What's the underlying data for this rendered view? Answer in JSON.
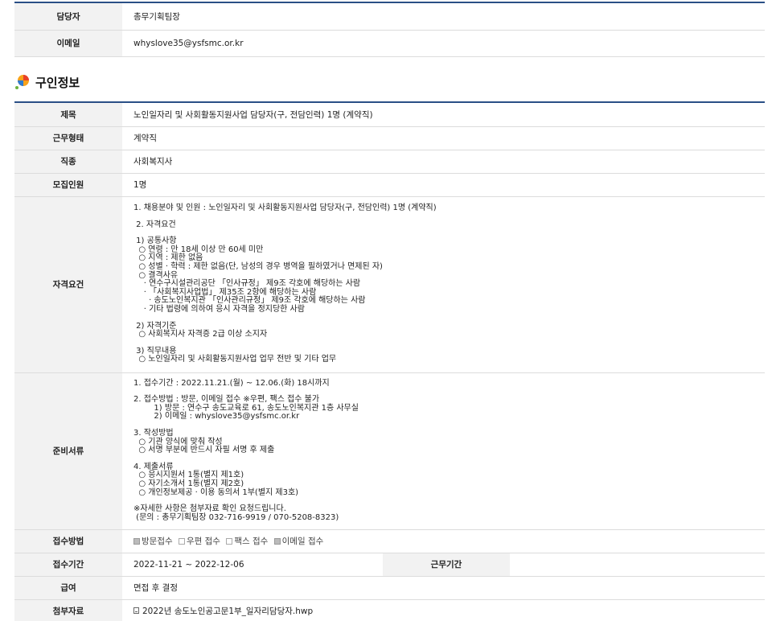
{
  "contact": {
    "rows": [
      {
        "label": "담당자",
        "value": "총무기획팀장"
      },
      {
        "label": "이메일",
        "value": "whyslove35@ysfsmc.or.kr"
      }
    ]
  },
  "section": {
    "title": "구인정보",
    "icon": "colorful-leaf-icon",
    "colors": [
      "#e8402a",
      "#f7a21b",
      "#2d7bd1",
      "#6db33f"
    ]
  },
  "job": {
    "title_label": "제목",
    "title_value": "노인일자리 및 사회활동지원사업 담당자(구, 전담인력) 1명 (계약직)",
    "type_label": "근무형태",
    "type_value": "계약직",
    "field_label": "직종",
    "field_value": "사회복지사",
    "count_label": "모집인원",
    "count_value": "1명",
    "qual_label": "자격요건",
    "qual_lines": [
      "1. 채용분야 및 인원 : 노인일자리 및 사회활동지원사업 담당자(구, 전담인력) 1명 (계약직)",
      "",
      " 2. 자격요건",
      "",
      " 1) 공통사항",
      "  ○ 연령 : 만 18세 이상 만 60세 미만",
      "  ○ 지역 : 제한 없음",
      "  ○ 성별 · 학력 : 제한 없음(단, 남성의 경우 병역을 필하였거나 면제된 자)",
      "  ○ 결격사유",
      "    · 연수구시설관리공단 「인사규정」 제9조 각호에 해당하는 사람",
      "    · 「사회복지사업법」 제35조 2항에 해당하는 사람",
      "      · 송도노인복지관 「인사관리규정」 제9조 각호에 해당하는 사람",
      "    · 기타 법령에 의하여 응시 자격을 정지당한 사람",
      "",
      " 2) 자격기준",
      "  ○ 사회복지사 자격증 2급 이상 소지자",
      "",
      " 3) 직무내용",
      "  ○ 노인일자리 및 사회활동지원사업 업무 전반 및 기타 업무"
    ],
    "docs_label": "준비서류",
    "docs_lines": [
      "1. 접수기간 : 2022.11.21.(월) ~ 12.06.(화) 18시까지",
      "",
      "2. 접수방법 : 방문, 이메일 접수 ※우편, 팩스 접수 불가",
      "        1) 방문 : 연수구 송도교육로 61, 송도노인복지관 1층 사무실",
      "        2) 이메일 : whyslove35@ysfsmc.or.kr",
      "",
      "3. 작성방법",
      "  ○ 기관 양식에 맞춰 작성",
      "  ○ 서명 부분에 반드시 자필 서명 후 제출",
      "",
      "4. 제출서류",
      "  ○ 응시지원서 1통(별지 제1호)",
      "  ○ 자기소개서 1통(별지 제2호)",
      "  ○ 개인정보제공 · 이용 동의서 1부(별지 제3호)",
      "",
      "※자세한 사항은 첨부자료 확인 요청드립니다.",
      " (문의 : 총무기획팀장 032-716-9919 / 070-5208-8323)"
    ],
    "method_label": "접수방법",
    "methods": [
      {
        "label": "방문접수",
        "checked": true
      },
      {
        "label": "우편 접수",
        "checked": false
      },
      {
        "label": "팩스 접수",
        "checked": false
      },
      {
        "label": "이메일 접수",
        "checked": true
      }
    ],
    "period_label": "접수기간",
    "period_value": "2022-11-21 ~ 2022-12-06",
    "work_period_label": "근무기간",
    "work_period_value": "",
    "salary_label": "급여",
    "salary_value": "면접 후 결정",
    "attach_label": "첨부자료",
    "attach_value": "2022년 송도노인공고문1부_일자리담당자.hwp"
  }
}
